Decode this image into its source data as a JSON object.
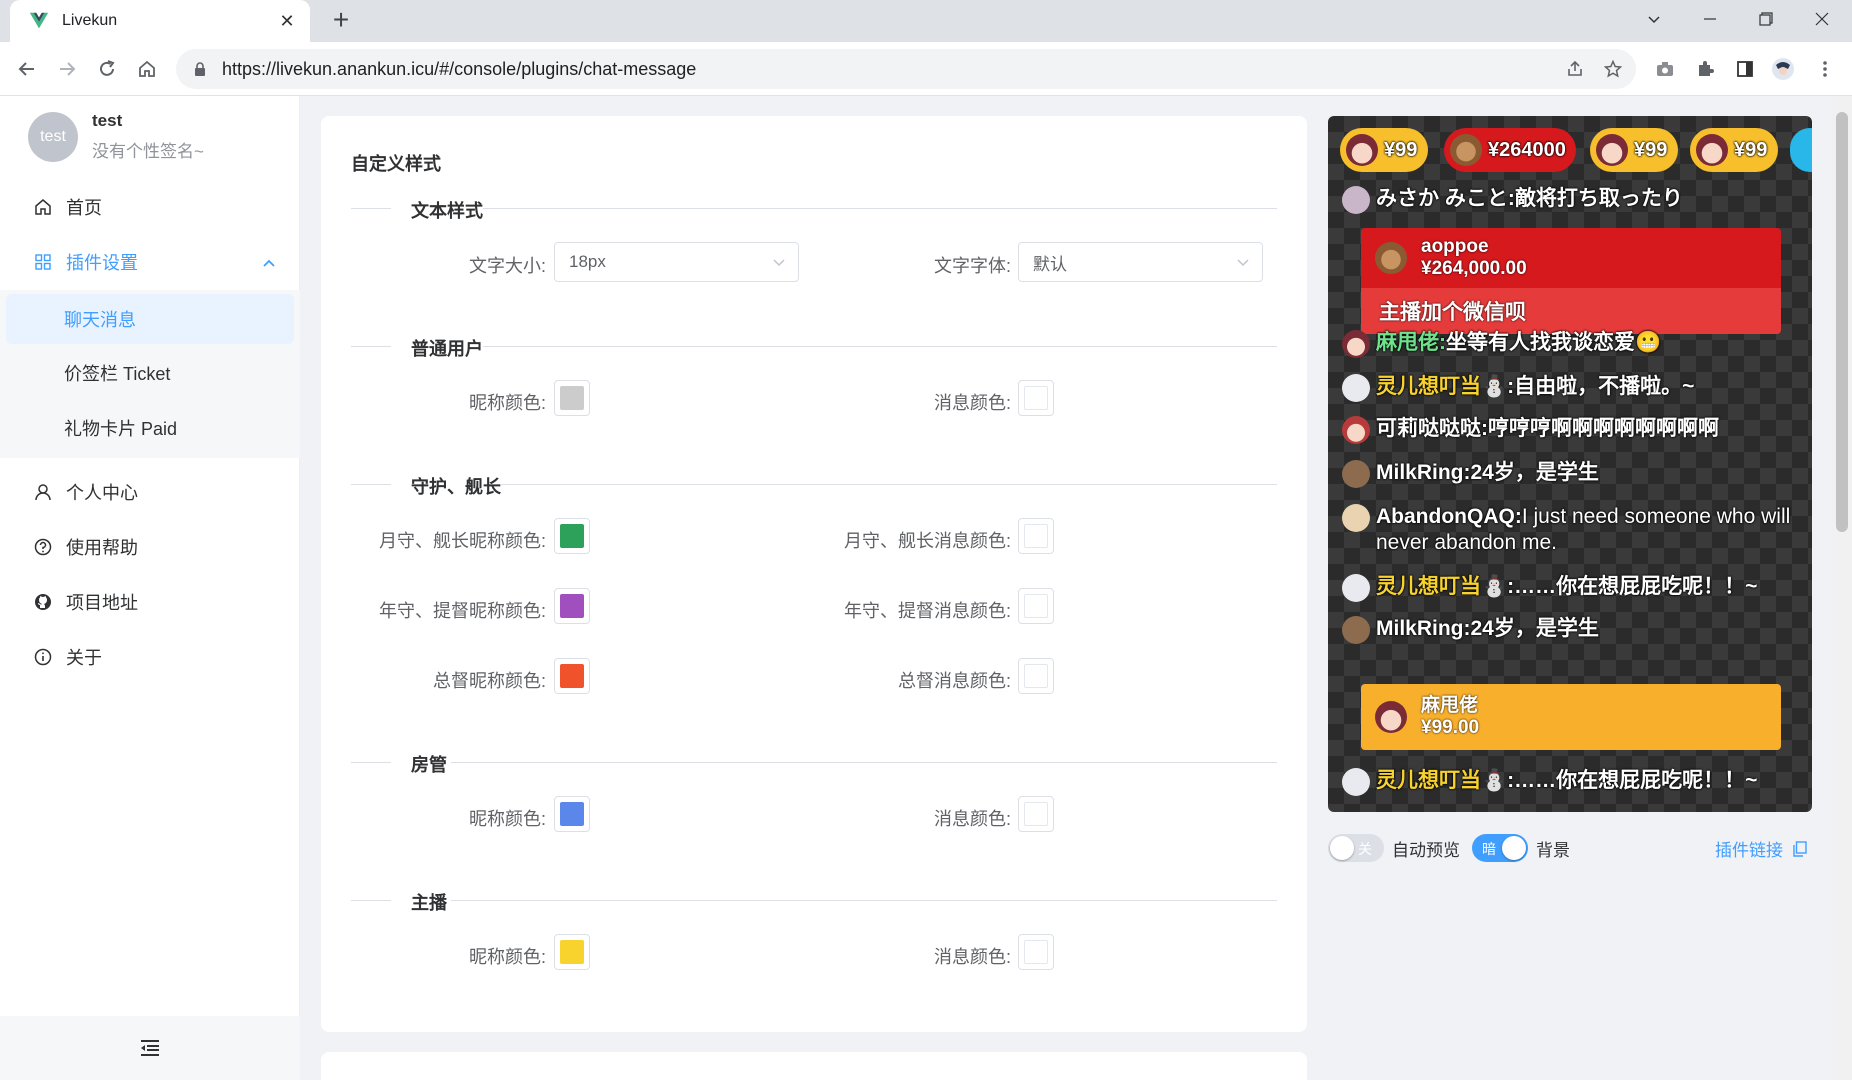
{
  "browser": {
    "tab_title": "Livekun",
    "url": "https://livekun.anankun.icu/#/console/plugins/chat-message"
  },
  "sidebar": {
    "avatar_text": "test",
    "username": "test",
    "signature": "没有个性签名~",
    "items": [
      {
        "label": "首页",
        "icon": "home-icon"
      },
      {
        "label": "插件设置",
        "icon": "grid-icon"
      },
      {
        "label": "个人中心",
        "icon": "user-icon"
      },
      {
        "label": "使用帮助",
        "icon": "help-icon"
      },
      {
        "label": "项目地址",
        "icon": "github-icon"
      },
      {
        "label": "关于",
        "icon": "info-icon"
      }
    ],
    "sub_items": [
      {
        "label": "聊天消息"
      },
      {
        "label": "价签栏 Ticket"
      },
      {
        "label": "礼物卡片 Paid"
      }
    ]
  },
  "form": {
    "title": "自定义样式",
    "sections": {
      "text_style": "文本样式",
      "normal_user": "普通用户",
      "guard": "守护、舰长",
      "admin": "房管",
      "streamer": "主播"
    },
    "labels": {
      "font_size": "文字大小:",
      "font_family": "文字字体:",
      "nick_color": "昵称颜色:",
      "msg_color": "消息颜色:",
      "guard3_nick": "月守、舰长昵称颜色:",
      "guard3_msg": "月守、舰长消息颜色:",
      "guard2_nick": "年守、提督昵称颜色:",
      "guard2_msg": "年守、提督消息颜色:",
      "guard1_nick": "总督昵称颜色:",
      "guard1_msg": "总督消息颜色:"
    },
    "values": {
      "font_size": "18px",
      "font_family": "默认"
    },
    "colors": {
      "normal_nick": "#cccccc",
      "guard3_nick": "#2da15a",
      "guard2_nick": "#a14fbf",
      "guard1_nick": "#f0532b",
      "admin_nick": "#5b87ea",
      "streamer_nick": "#f8d22d"
    }
  },
  "preview": {
    "tickets": [
      {
        "amount": "¥99",
        "color": "#f8bf2c"
      },
      {
        "amount": "¥264000",
        "color": "#d6191d"
      },
      {
        "amount": "¥99",
        "color": "#f8bf2c"
      },
      {
        "amount": "¥99",
        "color": "#f8bf2c"
      }
    ],
    "messages": [
      {
        "nick": "みさか みこと:",
        "text": "敵将打ち取ったり",
        "nick_color": "#ffffff"
      },
      {
        "nick": "麻甩佬:",
        "text": "坐等有人找我谈恋爱😬",
        "nick_color": "#6ee38c"
      },
      {
        "nick": "灵儿想叮当",
        "badge": "⛄",
        "text": ":自由啦，不播啦。~",
        "nick_color": "#f8d22d"
      },
      {
        "nick": "可莉哒哒哒:",
        "text": "哼哼哼啊啊啊啊啊啊啊啊",
        "nick_color": "#ffffff"
      },
      {
        "nick": "MilkRing:",
        "text": "24岁，是学生",
        "nick_color": "#ffffff"
      },
      {
        "nick": "AbandonQAQ:",
        "text": "I just need someone who will never abandon me.",
        "nick_color": "#ffffff"
      },
      {
        "nick": "灵儿想叮当",
        "badge": "⛄",
        "text": ":……你在想屁屁吃呢！！~",
        "nick_color": "#f8d22d"
      },
      {
        "nick": "MilkRing:",
        "text": "24岁，是学生",
        "nick_color": "#ffffff"
      },
      {
        "nick": "灵儿想叮当",
        "badge": "⛄",
        "text": ":……你在想屁屁吃呢！！~",
        "nick_color": "#f8d22d"
      }
    ],
    "superchats": [
      {
        "name": "aoppoe",
        "amount": "¥264,000.00",
        "message": "主播加个微信呗",
        "head_color": "#d6191d",
        "body_color": "#e63b3b"
      },
      {
        "name": "麻甩佬",
        "amount": "¥99.00",
        "message": "",
        "head_color": "#f8b02c",
        "body_color": "#f8b02c"
      }
    ],
    "auto_preview_toggle": "关",
    "auto_preview_label": "自动预览",
    "bg_toggle": "暗",
    "bg_label": "背景",
    "plugin_link": "插件链接"
  }
}
